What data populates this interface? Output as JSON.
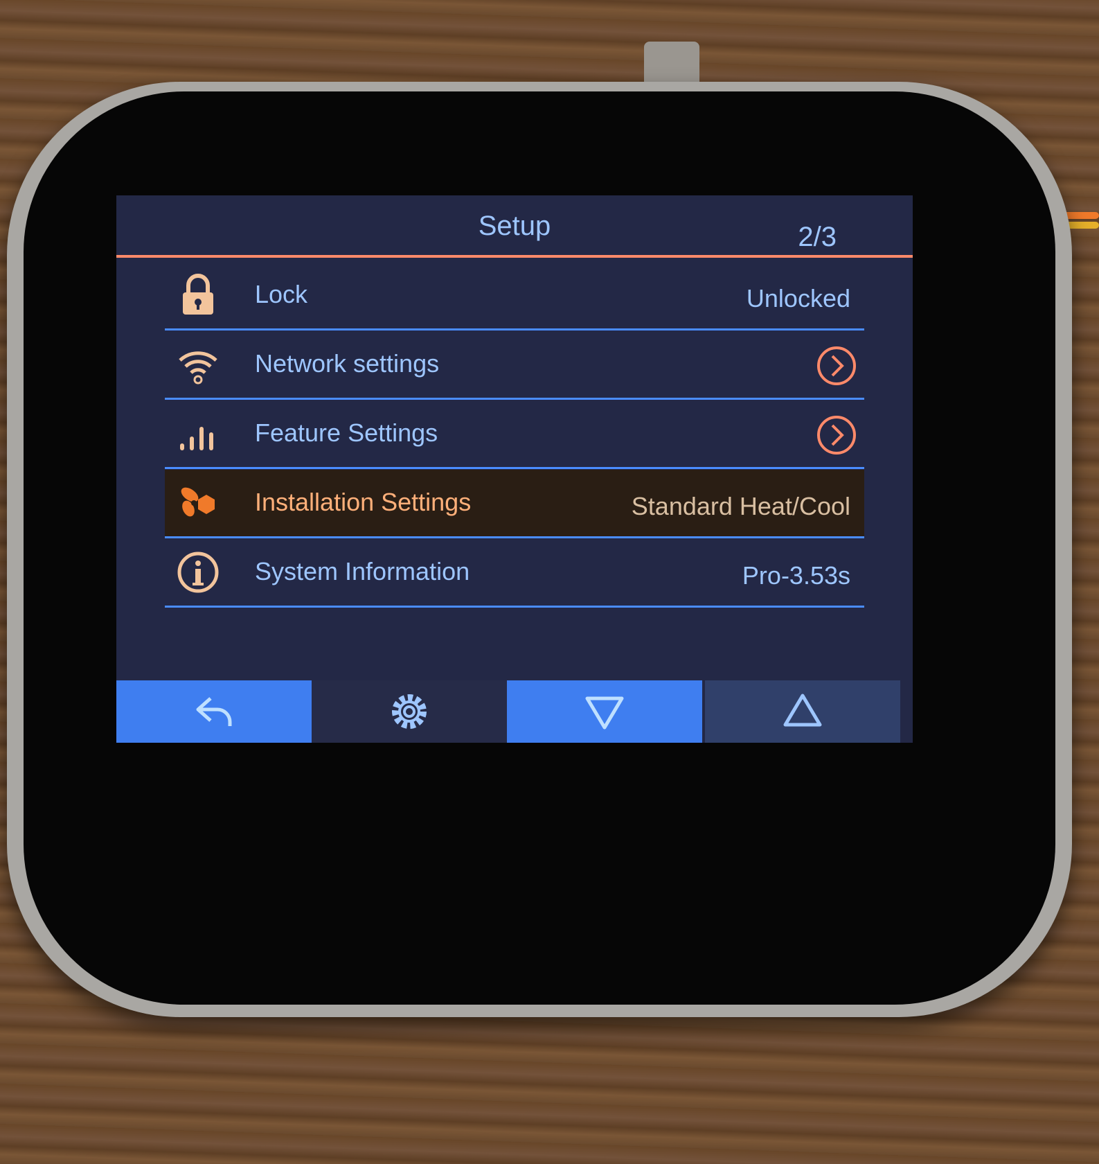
{
  "screen": {
    "title": "Setup",
    "page_indicator": "2/3"
  },
  "rows": [
    {
      "label": "Lock",
      "value": "Unlocked",
      "icon": "lock-icon"
    },
    {
      "label": "Network settings",
      "icon": "wifi-icon",
      "action": "chevron-right-icon"
    },
    {
      "label": "Feature Settings",
      "icon": "signal-bars-icon",
      "action": "chevron-right-icon"
    },
    {
      "label": "Installation Settings",
      "value": "Standard Heat/Cool",
      "icon": "fan-icon",
      "selected": true
    },
    {
      "label": "System Information",
      "value": "Pro-3.53s",
      "icon": "info-icon"
    }
  ],
  "nav": {
    "back": "back-arrow-icon",
    "settings": "gear-icon",
    "down": "triangle-down-icon",
    "up": "triangle-up-icon"
  },
  "colors": {
    "text": "#9ec6ff",
    "accent": "#ff8a6a",
    "divider": "#4a8cff",
    "button": "#3f7ef0",
    "screen_bg": "#232846"
  }
}
